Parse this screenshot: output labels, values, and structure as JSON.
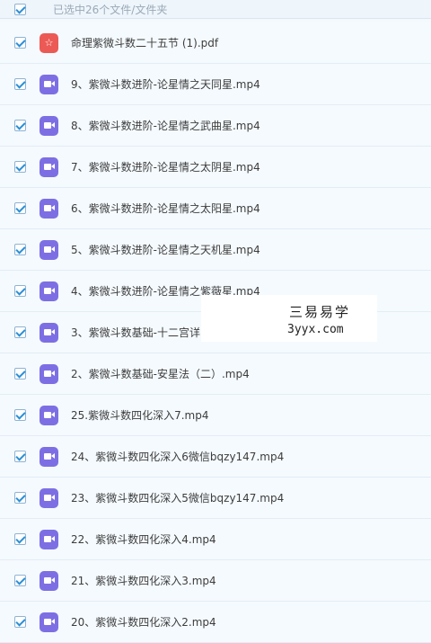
{
  "header": {
    "selection_text": "已选中26个文件/文件夹"
  },
  "files": [
    {
      "name": "命理紫微斗数二十五节 (1).pdf",
      "icon": "pdf-icon",
      "type": "pdf"
    },
    {
      "name": "9、紫微斗数进阶-论星情之天同星.mp4",
      "icon": "video-icon",
      "type": "video"
    },
    {
      "name": "8、紫微斗数进阶-论星情之武曲星.mp4",
      "icon": "video-icon",
      "type": "video"
    },
    {
      "name": "7、紫微斗数进阶-论星情之太阴星.mp4",
      "icon": "video-icon",
      "type": "video"
    },
    {
      "name": "6、紫微斗数进阶-论星情之太阳星.mp4",
      "icon": "video-icon",
      "type": "video"
    },
    {
      "name": "5、紫微斗数进阶-论星情之天机星.mp4",
      "icon": "video-icon",
      "type": "video"
    },
    {
      "name": "4、紫微斗数进阶-论星情之紫薇星.mp4",
      "icon": "video-icon",
      "type": "video"
    },
    {
      "name": "3、紫微斗数基础-十二宫详",
      "icon": "video-icon",
      "type": "video"
    },
    {
      "name": "2、紫微斗数基础-安星法（二）.mp4",
      "icon": "video-icon",
      "type": "video"
    },
    {
      "name": "25.紫微斗数四化深入7.mp4",
      "icon": "video-icon",
      "type": "video"
    },
    {
      "name": "24、紫微斗数四化深入6微信bqzy147.mp4",
      "icon": "video-icon",
      "type": "video"
    },
    {
      "name": "23、紫微斗数四化深入5微信bqzy147.mp4",
      "icon": "video-icon",
      "type": "video"
    },
    {
      "name": "22、紫微斗数四化深入4.mp4",
      "icon": "video-icon",
      "type": "video"
    },
    {
      "name": "21、紫微斗数四化深入3.mp4",
      "icon": "video-icon",
      "type": "video"
    },
    {
      "name": "20、紫微斗数四化深入2.mp4",
      "icon": "video-icon",
      "type": "video"
    }
  ],
  "watermark": {
    "line1": "三易易学",
    "line2": "3yyx.com"
  },
  "colors": {
    "video_icon": "#7d6fe3",
    "pdf_icon": "#ec5a56",
    "checkbox_check": "#2b8fd6"
  }
}
